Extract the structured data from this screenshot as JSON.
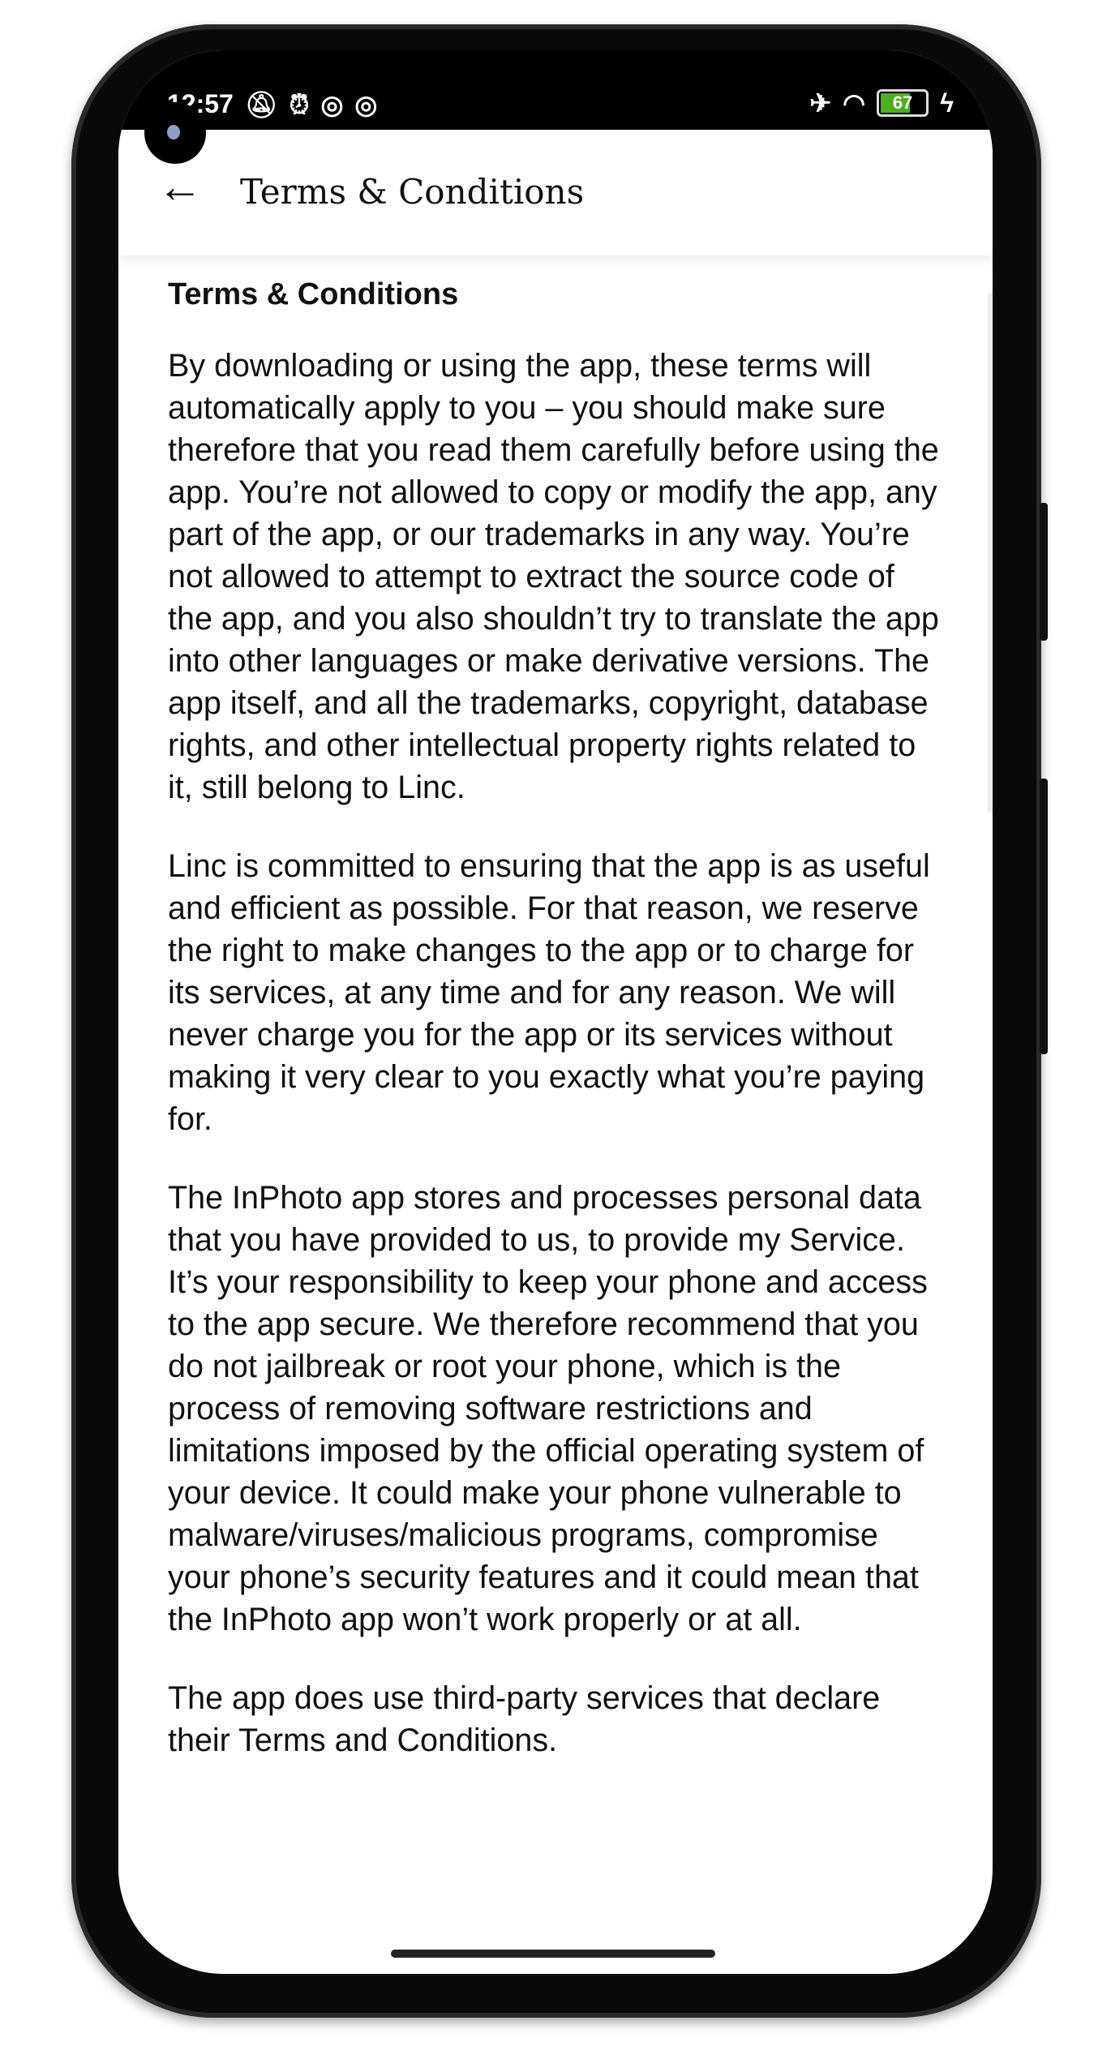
{
  "status_bar": {
    "time": "12:57",
    "battery": "67",
    "icons_left": [
      "bell-off-icon",
      "alarm-icon",
      "vpn-icon",
      "vpn-icon"
    ],
    "icons_right": [
      "airplane-icon",
      "wifi-icon",
      "battery-icon",
      "charging-icon"
    ],
    "battery_color": "#4caf1c"
  },
  "app_bar": {
    "title": "Terms & Conditions",
    "back_icon": "arrow-left-icon"
  },
  "content": {
    "heading": "Terms & Conditions",
    "paragraphs": [
      "By downloading or using the app, these terms will automatically apply to you – you should make sure therefore that you read them carefully before using the app. You’re not allowed to copy or modify the app, any part of the app, or our trademarks in any way. You’re not allowed to attempt to extract the source code of the app, and you also shouldn’t try to translate the app into other languages or make derivative versions. The app itself, and all the trademarks, copyright, database rights, and other intellectual property rights related to it, still belong to Linc.",
      "Linc is committed to ensuring that the app is as useful and efficient as possible. For that reason, we reserve the right to make changes to the app or to charge for its services, at any time and for any reason. We will never charge you for the app or its services without making it very clear to you exactly what you’re paying for.",
      "The InPhoto app stores and processes personal data that you have provided to us, to provide my Service. It’s your responsibility to keep your phone and access to the app secure. We therefore recommend that you do not jailbreak or root your phone, which is the process of removing software restrictions and limitations imposed by the official operating system of your device. It could make your phone vulnerable to malware/viruses/malicious programs, compromise your phone’s security features and it could mean that the InPhoto app won’t work properly or at all.",
      "The app does use third-party services that declare their Terms and Conditions."
    ]
  }
}
